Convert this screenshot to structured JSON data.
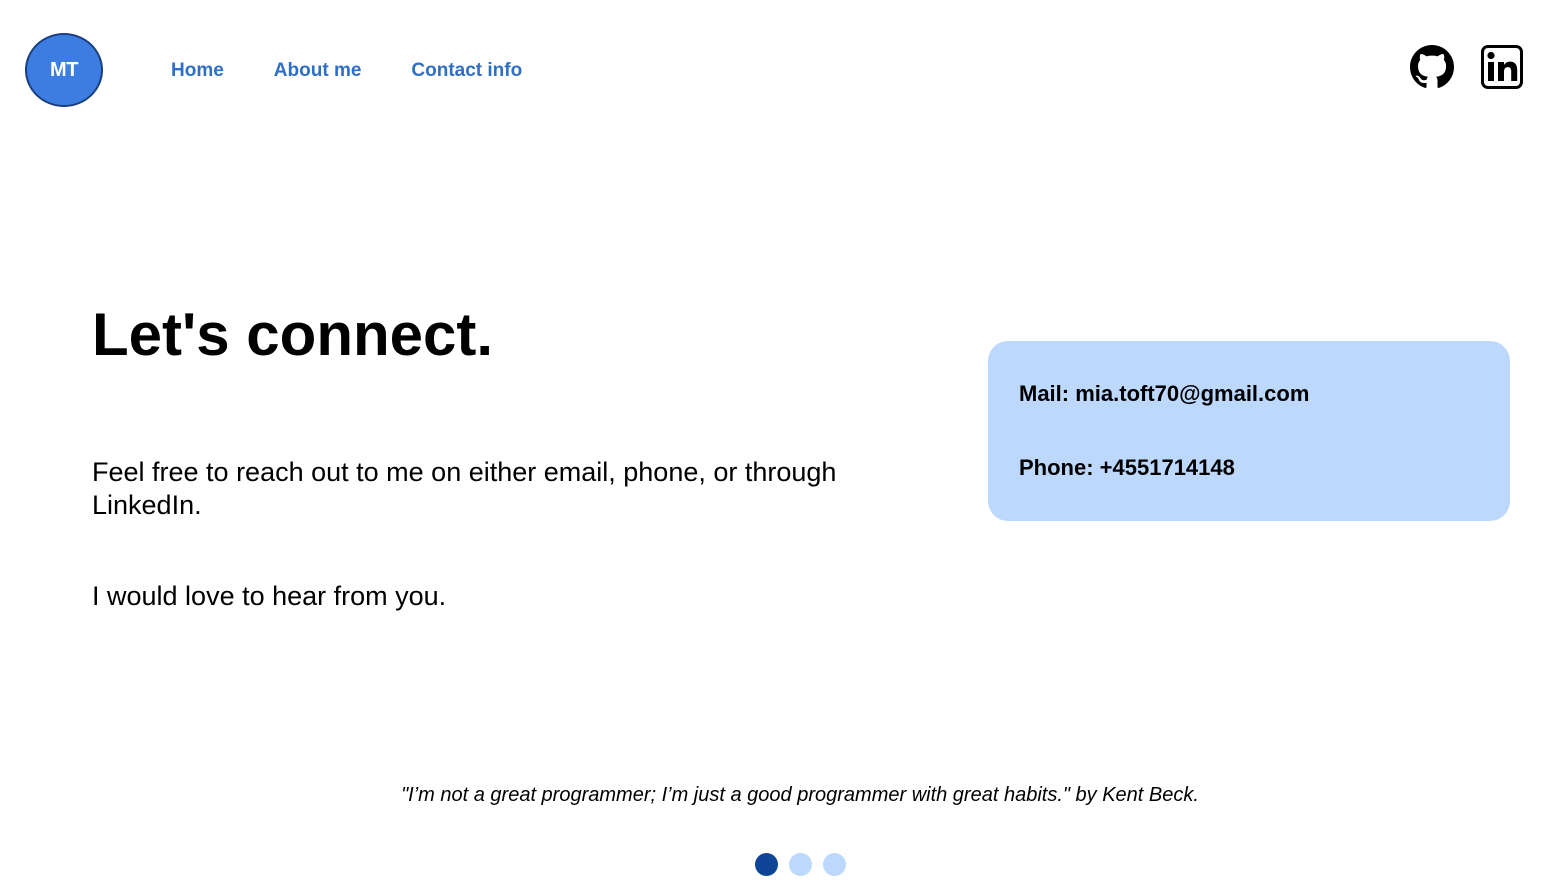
{
  "header": {
    "logo_text": "MT",
    "nav": [
      {
        "label": "Home"
      },
      {
        "label": "About me"
      },
      {
        "label": "Contact info"
      }
    ],
    "social": [
      {
        "icon": "github-icon"
      },
      {
        "icon": "linkedin-icon"
      }
    ]
  },
  "main": {
    "heading": "Let's connect.",
    "paragraphs": [
      "Feel free to reach out to me on either email, phone, or through LinkedIn.",
      "I would love to hear from you."
    ],
    "contact": {
      "mail": "Mail: mia.toft70@gmail.com",
      "phone": "Phone: +4551714148"
    }
  },
  "footer": {
    "quote": "\"I’m not a great programmer; I’m just a good programmer with great habits.\" by Kent Beck.",
    "carousel": {
      "count": 3,
      "active_index": 0
    }
  },
  "colors": {
    "accent": "#3b7de0",
    "nav_link": "#2f6fc6",
    "card_bg": "#bcd8fc",
    "dot_active": "#0f4597",
    "dot_inactive": "#bcd8fc"
  }
}
